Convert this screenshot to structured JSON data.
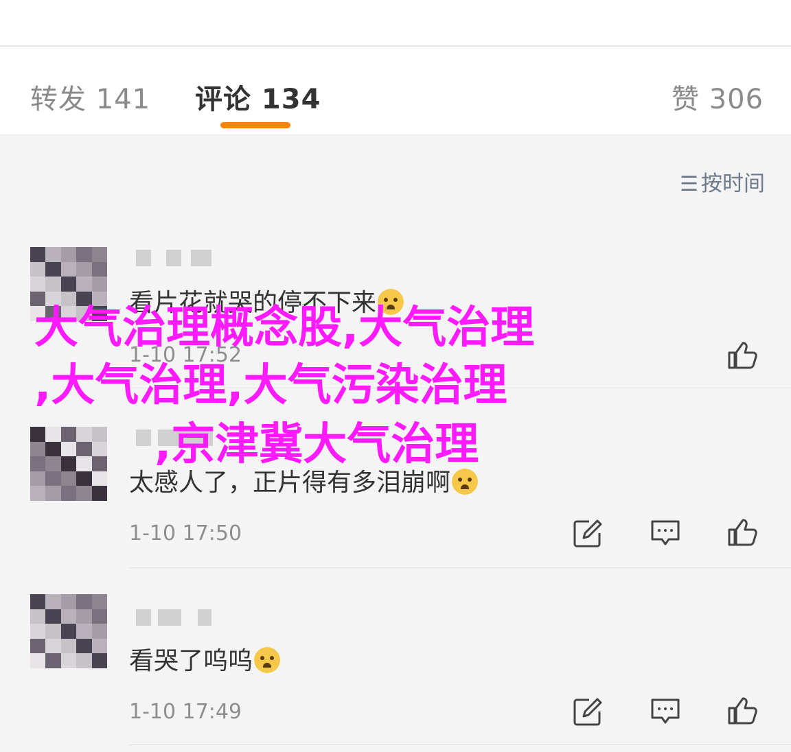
{
  "tabs": {
    "repost": "转发 141",
    "comments": "评论 134",
    "likes": "赞 306"
  },
  "colors": {
    "accent": "#ff8200",
    "overlay": "#ff1aff"
  },
  "sort": {
    "icon": "sort-icon",
    "label": "按时间"
  },
  "comments": [
    {
      "text": "看片花就哭的停不下来",
      "time": "1-10 17:52"
    },
    {
      "text": "太感人了，正片得有多泪崩啊",
      "time": "1-10 17:50"
    },
    {
      "text": "看哭了呜呜",
      "time": "1-10 17:49"
    }
  ],
  "overlay": {
    "line1": "大气治理概念股,大气治理",
    "line2": ",大气治理,大气污染治理",
    "line3": ",京津冀大气治理"
  }
}
